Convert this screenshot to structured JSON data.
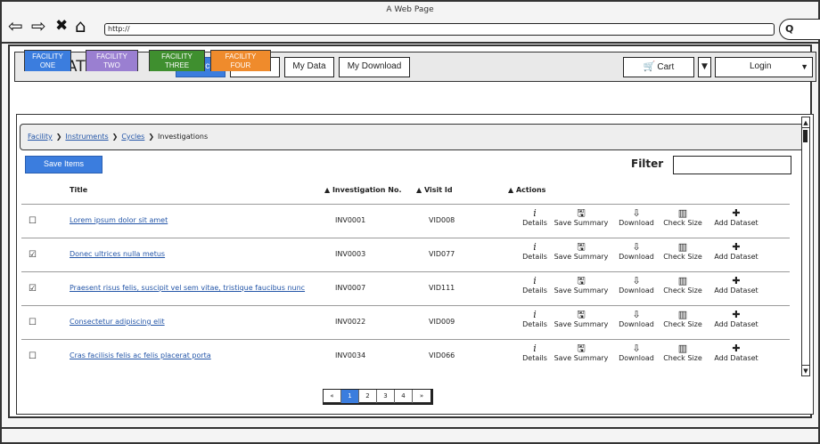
{
  "window": {
    "title": "A Web Page",
    "url": "http://"
  },
  "appbar": {
    "brand": "TOPCAT",
    "nav": [
      "Search",
      "Browse",
      "My Data",
      "My Download"
    ],
    "cart_label": "Cart",
    "login_label": "Login"
  },
  "facility_tabs": [
    {
      "line1": "FACILITY",
      "line2": "ONE",
      "color": "#3b7dde"
    },
    {
      "line1": "FACILITY",
      "line2": "TWO",
      "color": "#9a7fd1"
    },
    {
      "line1": "FACILITY",
      "line2": "THREE",
      "color": "#3f8f2f"
    },
    {
      "line1": "FACILITY",
      "line2": "FOUR",
      "color": "#ef8b2c"
    }
  ],
  "breadcrumb": {
    "links": [
      "Facility",
      "Instruments",
      "Cycles"
    ],
    "current": "Investigations",
    "separator": ">"
  },
  "toolbar": {
    "save_label": "Save Items",
    "filter_label": "Filter",
    "filter_value": ""
  },
  "table": {
    "headers": {
      "title": "Title",
      "inv": "Investigation No.",
      "visit": "Visit Id",
      "actions": "Actions",
      "sort_glyph": "▲"
    },
    "action_labels": {
      "details": "Details",
      "save_summary": "Save Summary",
      "download": "Download",
      "check_size": "Check Size",
      "add_dataset": "Add Dataset"
    },
    "rows": [
      {
        "checked": false,
        "title": "Lorem ipsum dolor sit amet",
        "inv": "INV0001",
        "visit": "VID008"
      },
      {
        "checked": true,
        "title": "Donec ultrices nulla metus",
        "inv": "INV0003",
        "visit": "VID077"
      },
      {
        "checked": true,
        "title": "Praesent risus felis, suscipit vel sem vitae, tristique faucibus nunc",
        "inv": "INV0007",
        "visit": "VID111"
      },
      {
        "checked": false,
        "title": "Consectetur adipiscing elit",
        "inv": "INV0022",
        "visit": "VID009"
      },
      {
        "checked": false,
        "title": "Cras facilisis felis ac felis placerat porta",
        "inv": "INV0034",
        "visit": "VID066"
      }
    ]
  },
  "pagination": {
    "prev": "«",
    "pages": [
      "1",
      "2",
      "3",
      "4"
    ],
    "current": "1",
    "next": "»"
  },
  "colors": {
    "accent": "#3b7dde",
    "link": "#2456a8"
  }
}
